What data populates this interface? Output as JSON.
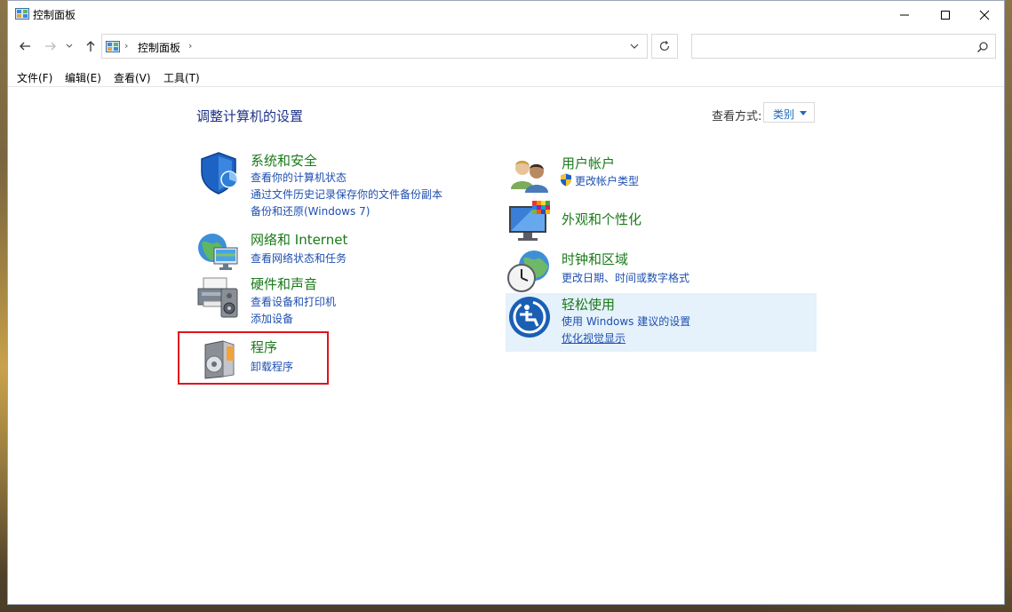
{
  "window": {
    "title": "控制面板"
  },
  "address_bar": {
    "path": "控制面板",
    "separator": "›"
  },
  "search": {
    "placeholder": ""
  },
  "menu": [
    "文件(F)",
    "编辑(E)",
    "查看(V)",
    "工具(T)"
  ],
  "content": {
    "title": "调整计算机的设置",
    "view_by_label": "查看方式:",
    "view_by_value": "类别"
  },
  "categories": {
    "system": {
      "title": "系统和安全",
      "links": [
        "查看你的计算机状态",
        "通过文件历史记录保存你的文件备份副本",
        "备份和还原(Windows 7)"
      ]
    },
    "network": {
      "title": "网络和 Internet",
      "links": [
        "查看网络状态和任务"
      ]
    },
    "hardware": {
      "title": "硬件和声音",
      "links": [
        "查看设备和打印机",
        "添加设备"
      ]
    },
    "programs": {
      "title": "程序",
      "links": [
        "卸载程序"
      ]
    },
    "users": {
      "title": "用户帐户",
      "links": [
        "更改帐户类型"
      ]
    },
    "appearance": {
      "title": "外观和个性化",
      "links": []
    },
    "clock": {
      "title": "时钟和区域",
      "links": [
        "更改日期、时间或数字格式"
      ]
    },
    "ease": {
      "title": "轻松使用",
      "links": [
        "使用 Windows 建议的设置",
        "优化视觉显示"
      ]
    }
  },
  "colors": {
    "category_title": "#1a7a1a",
    "link": "#1e4fb0",
    "page_title": "#1e3287",
    "highlight": "#e5f1fb",
    "annotation_box": "#e0131b"
  }
}
